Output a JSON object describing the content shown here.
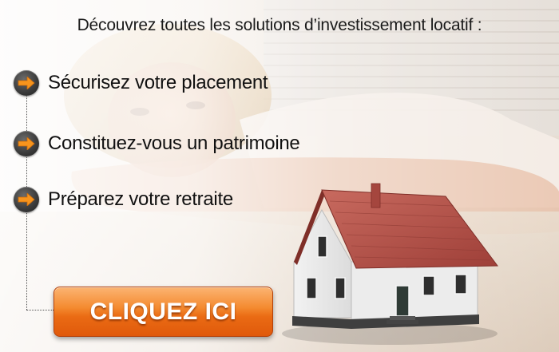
{
  "headline": "Découvrez toutes les solutions d’investissement locatif :",
  "benefits": [
    {
      "label": "Sécurisez votre placement",
      "icon": "arrow-right-icon"
    },
    {
      "label": "Constituez-vous un patrimoine",
      "icon": "arrow-right-icon"
    },
    {
      "label": "Préparez votre retraite",
      "icon": "arrow-right-icon"
    }
  ],
  "cta": {
    "label": "CLIQUEZ ICI"
  },
  "colors": {
    "accent_orange": "#ee7a1e",
    "icon_arrow_orange": "#f7941d",
    "icon_circle": "#3d3d3d",
    "roof": "#b5524a",
    "text": "#111111"
  }
}
